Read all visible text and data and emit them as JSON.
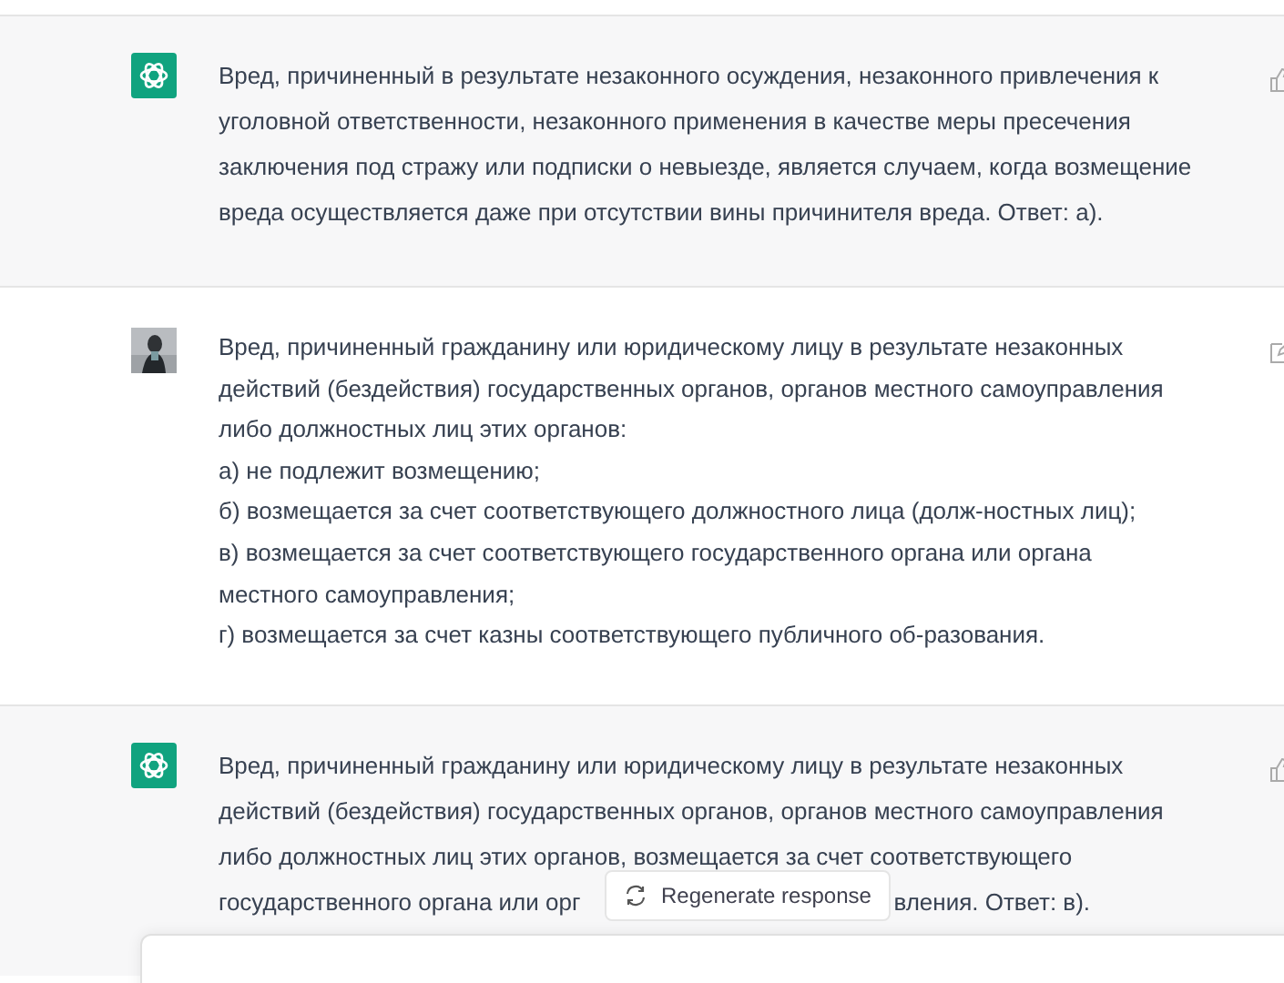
{
  "messages": [
    {
      "kind": "assistant",
      "lines": [
        "Вред, причиненный в результате незаконного осуждения, незаконного привлечения к",
        "уголовной ответственности, незаконного применения в качестве меры пресечения",
        "заключения под стражу или подписки о невыезде, является случаем, когда возмещение",
        "вреда осуществляется даже при отсутствии вины причинителя вреда. Ответ: а)."
      ]
    },
    {
      "kind": "user",
      "lines": [
        "Вред, причиненный гражданину или юридическому лицу в результате незаконных",
        "действий (бездействия) государственных органов, органов местного самоуправления",
        "либо должностных лиц этих органов:",
        "а) не подлежит возмещению;",
        "б) возмещается за счет соответствующего должностного лица (долж-ностных лиц);",
        "в) возмещается за счет соответствующего государственного органа или органа",
        "местного самоуправления;",
        "г) возмещается за счет казны соответствующего публичного об-разования."
      ]
    },
    {
      "kind": "assistant",
      "lines": [
        "Вред, причиненный гражданину или юридическому лицу в результате незаконных",
        "действий (бездействия) государственных органов, органов местного самоуправления",
        "либо должностных лиц этих органов, возмещается за счет соответствующего"
      ],
      "covered_line": [
        "государственного органа или орг",
        "вления. Ответ: в)."
      ]
    }
  ],
  "regenerate_button": "Regenerate response"
}
